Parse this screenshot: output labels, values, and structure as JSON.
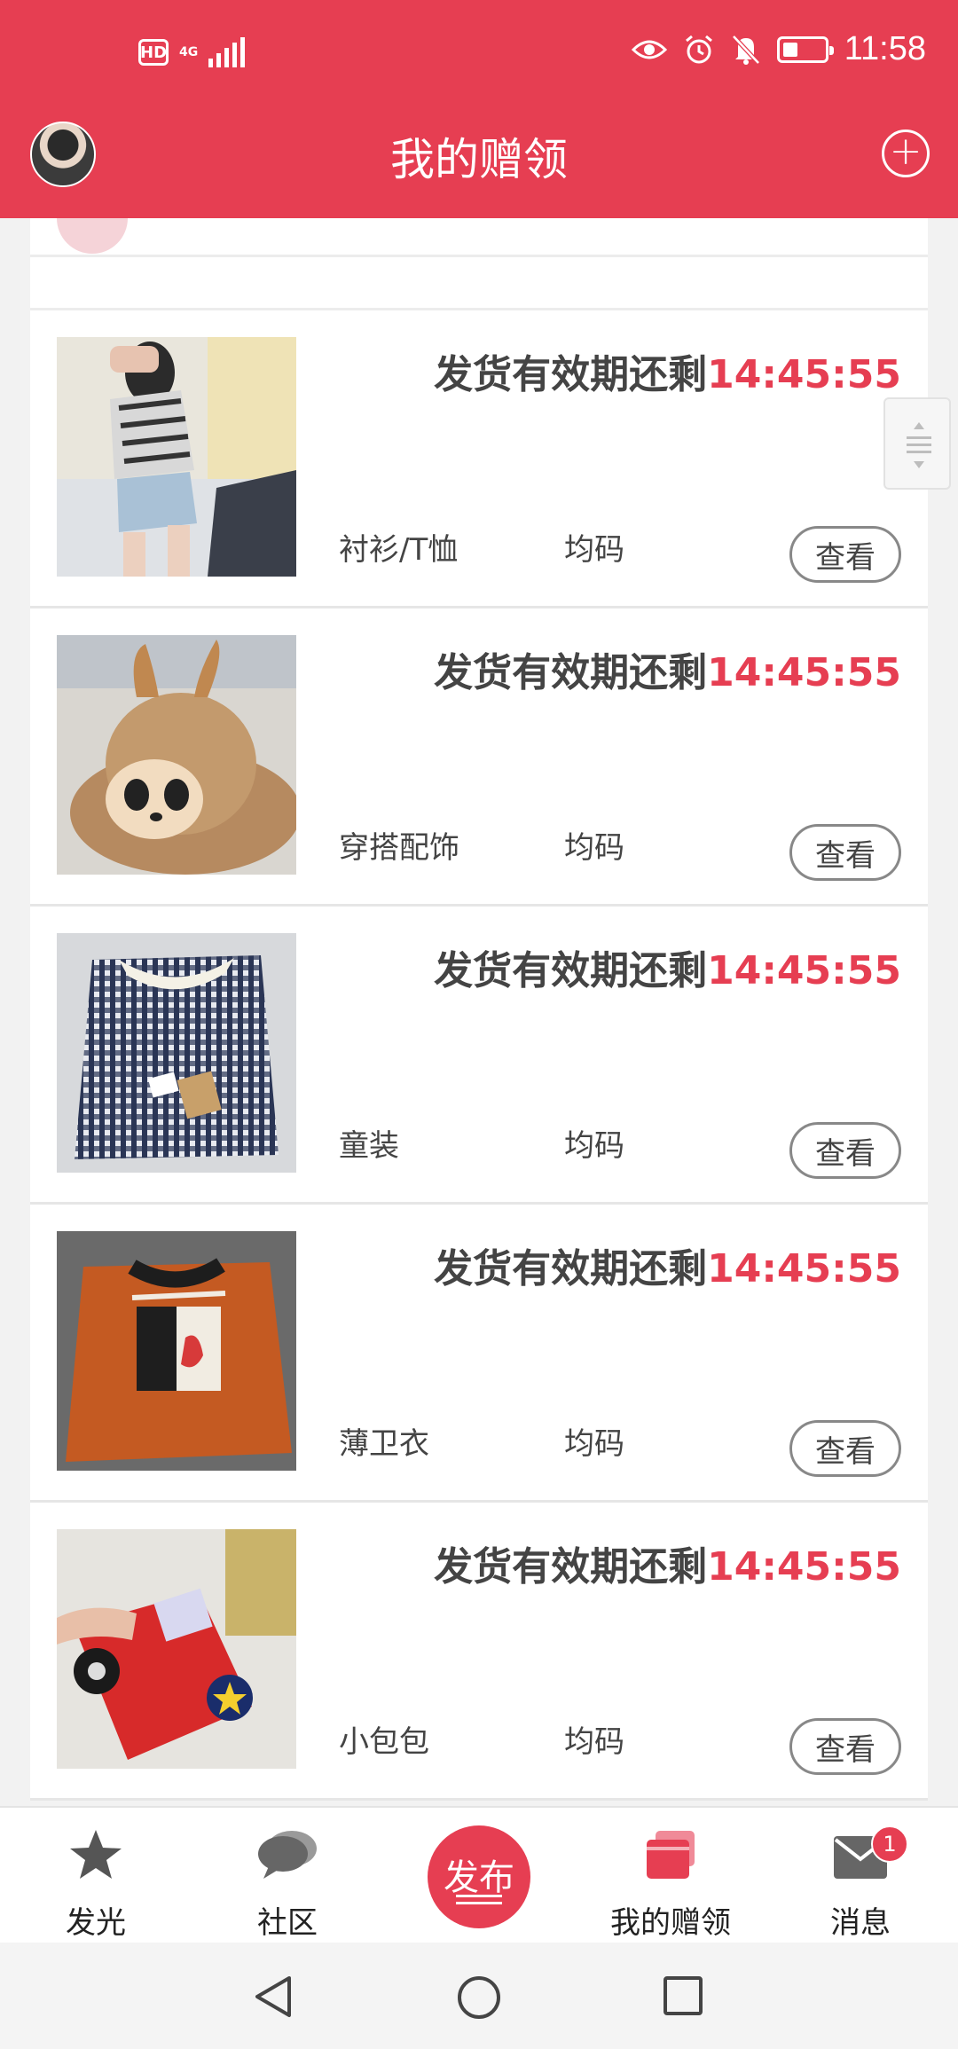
{
  "status_bar": {
    "hd": "HD",
    "network": "4G",
    "time": "11:58"
  },
  "header": {
    "title": "我的赠领"
  },
  "items": [
    {
      "countdown_label": "发货有效期还剩",
      "countdown_time": "14:45:55",
      "category": "衬衫/T恤",
      "size": "均码",
      "view_label": "查看",
      "thumb_icon": "shirt-photo"
    },
    {
      "countdown_label": "发货有效期还剩",
      "countdown_time": "14:45:55",
      "category": "穿搭配饰",
      "size": "均码",
      "view_label": "查看",
      "thumb_icon": "hat-photo"
    },
    {
      "countdown_label": "发货有效期还剩",
      "countdown_time": "14:45:55",
      "category": "童装",
      "size": "均码",
      "view_label": "查看",
      "thumb_icon": "plaid-dress-photo"
    },
    {
      "countdown_label": "发货有效期还剩",
      "countdown_time": "14:45:55",
      "category": "薄卫衣",
      "size": "均码",
      "view_label": "查看",
      "thumb_icon": "orange-sweatshirt-photo"
    },
    {
      "countdown_label": "发货有效期还剩",
      "countdown_time": "14:45:55",
      "category": "小包包",
      "size": "均码",
      "view_label": "查看",
      "thumb_icon": "police-bag-photo"
    }
  ],
  "bottom_nav": {
    "items": [
      {
        "label": "发光",
        "icon": "star-icon"
      },
      {
        "label": "社区",
        "icon": "chat-bubble-icon"
      },
      {
        "label": "我的赠领",
        "icon": "gift-cards-icon"
      },
      {
        "label": "消息",
        "icon": "mail-icon",
        "badge": "1"
      }
    ],
    "publish_label": "发布"
  },
  "colors": {
    "accent": "#e63e52",
    "text": "#444444"
  }
}
